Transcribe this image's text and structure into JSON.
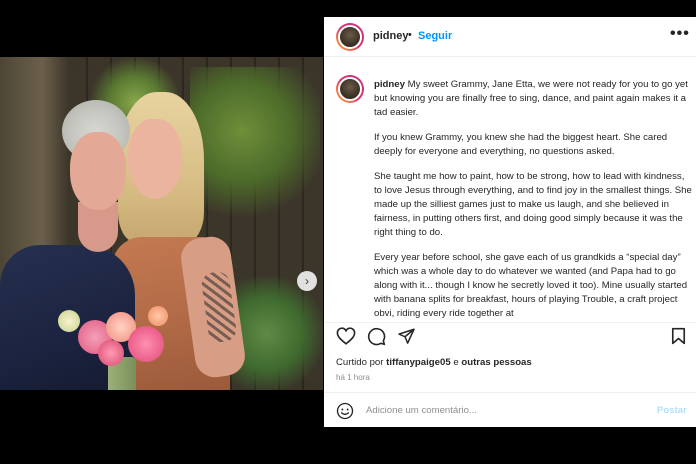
{
  "post": {
    "username": "pidney",
    "separator": "•",
    "follow_label": "Seguir",
    "more_label": "•••",
    "caption_paragraphs": [
      "My sweet Grammy, Jane Etta, we were not ready for you to go yet but knowing you are finally free to sing, dance, and paint again makes it a tad easier.",
      "If you knew Grammy, you knew she had the biggest heart. She cared deeply for everyone and everything, no questions asked.",
      "She taught me how to paint, how to be strong, how to lead with kindness, to love Jesus through everything, and to find joy in the smallest things. She made up the silliest games just to make us laugh, and she believed in fairness, in putting others first, and doing good simply because it was the right thing to do.",
      "Every year before school, she gave each of us grandkids a “special day” which was a whole day to do whatever we wanted (and Papa had to go along with it... though I know he secretly loved it too). Mine usually started with banana splits for breakfast, hours of playing Trouble, a craft project obvi, riding every ride together at"
    ],
    "likes_prefix": "Curtido por",
    "likes_user": "tiffanypaige05",
    "likes_suffix": "e",
    "likes_others": "outras pessoas",
    "timestamp": "há 1 hora",
    "comment_placeholder": "Adicione um comentário...",
    "post_button": "Postar"
  },
  "carousel": {
    "total_slides": 14,
    "active_index": 0,
    "next_glyph": "›"
  },
  "colors": {
    "link_blue": "#0095f6",
    "post_disabled": "#b2dffc",
    "text": "#262626",
    "muted": "#8e8e8e"
  },
  "icons": [
    "heart-icon",
    "comment-icon",
    "share-icon",
    "bookmark-icon",
    "emoji-icon",
    "more-icon",
    "chevron-right-icon"
  ]
}
